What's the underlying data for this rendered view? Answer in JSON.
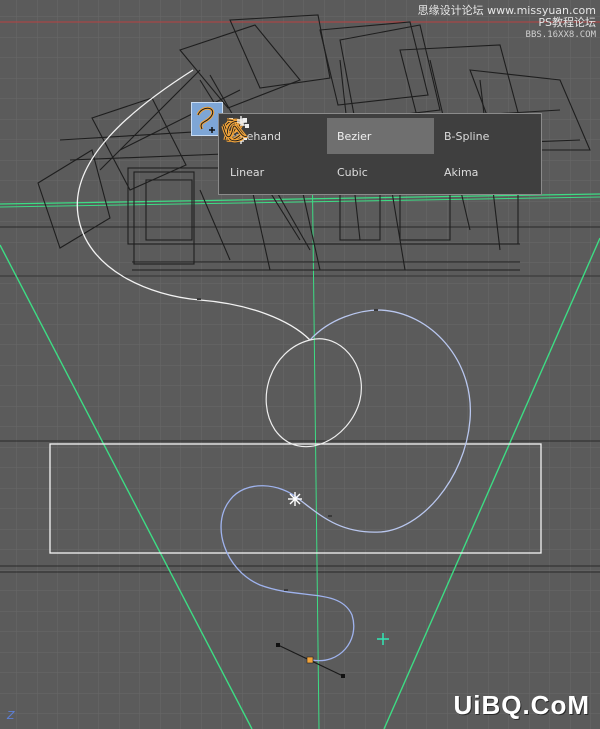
{
  "spline_menu": {
    "items": [
      {
        "label": "Freehand",
        "icon": "freehand-spline-icon",
        "selected": false
      },
      {
        "label": "Bezier",
        "icon": "bezier-spline-icon",
        "selected": true
      },
      {
        "label": "B-Spline",
        "icon": "bspline-icon",
        "selected": false
      },
      {
        "label": "Linear",
        "icon": "linear-spline-icon",
        "selected": false
      },
      {
        "label": "Cubic",
        "icon": "cubic-spline-icon",
        "selected": false
      },
      {
        "label": "Akima",
        "icon": "akima-spline-icon",
        "selected": false
      }
    ]
  },
  "watermark_top": {
    "line1": "思缘设计论坛 www.missyuan.com",
    "line2": "PS教程论坛",
    "line3": "BBS.16XX8.COM"
  },
  "watermark_bottom": "UiBQ.CoM",
  "axis_label": "Z",
  "colors": {
    "background": "#5b5b5b",
    "grid": "#686868",
    "guide_green": "#3ddc84",
    "spline_white": "#f2f2f2",
    "spline_blue": "#9fb3ee",
    "menu_bg": "#3f3f3f",
    "menu_selected": "#6f6f6f",
    "icon_orange": "#f2a43a",
    "tool_active": "#7ea6d6"
  }
}
